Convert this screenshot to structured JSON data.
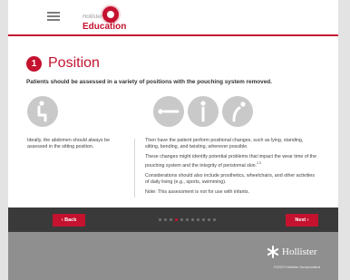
{
  "header": {
    "logo_small": "Hollister",
    "logo_title": "Education"
  },
  "step": {
    "number": "1",
    "title": "Position",
    "subtitle": "Patients should be assessed in a variety of positions with the pouching system removed."
  },
  "icons": {
    "sit": "sitting-icon",
    "lie": "lying-icon",
    "stand": "standing-icon",
    "bend": "bending-icon"
  },
  "left_text": "Ideally, the abdomen should always be assessed in the sitting position.",
  "right_text": {
    "p1": "Then have the patient perform positional changes, such as lying, standing, sitting, bending, and twisting, wherever possible.",
    "p2": "These changes might identify potential problems that impact the wear time of the pouching system and the integrity of peristomal skin.",
    "p2_ref": "2,3",
    "p3": "Considerations should also include prosthetics, wheelchairs, and other activities of daily living (e.g., sports, swimming).",
    "p4": "Note: This assessment is not for use with infants."
  },
  "nav": {
    "back_label": "Back",
    "next_label": "Next",
    "total_pages": 11,
    "current_page": 4
  },
  "footer": {
    "brand": "Hollister",
    "copyright": "©2023 Hollister Incorporated"
  },
  "colors": {
    "accent": "#c4122f",
    "nav_bg": "#3a3a3a",
    "footer_bg": "#8f8f8f",
    "icon_bg": "#c9c9c9"
  }
}
